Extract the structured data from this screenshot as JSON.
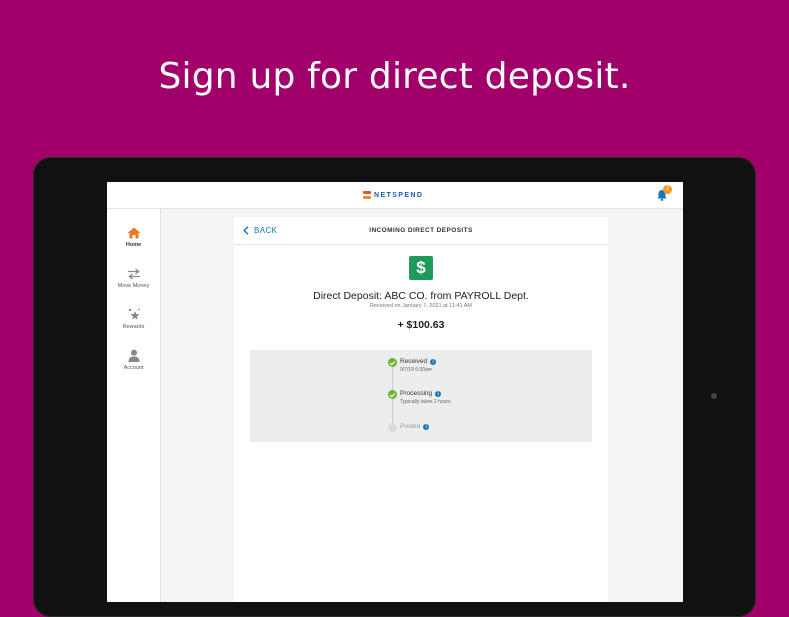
{
  "headline": "Sign up for direct deposit.",
  "app": {
    "brand": "NETSPEND",
    "notification_count": "2"
  },
  "sidebar": {
    "items": [
      {
        "label": "Home",
        "icon": "home-icon",
        "active": true
      },
      {
        "label": "Move Money",
        "icon": "transfer-icon",
        "active": false
      },
      {
        "label": "Rewards",
        "icon": "rewards-icon",
        "active": false
      },
      {
        "label": "Account",
        "icon": "account-icon",
        "active": false
      }
    ]
  },
  "card": {
    "back_label": "BACK",
    "title": "INCOMING DIRECT DEPOSITS",
    "icon": "dollar-icon",
    "deposit_title": "Direct Deposit: ABC CO. from PAYROLL Dept.",
    "received_on": "Received on January 7, 2021 at 11:41 AM",
    "amount": "+ $100.63"
  },
  "timeline": {
    "steps": [
      {
        "label": "Received",
        "sub": "9/7/19 6:00am",
        "status": "done"
      },
      {
        "label": "Processing",
        "sub": "Typically takes 2 hours",
        "status": "done"
      },
      {
        "label": "Posted",
        "sub": "",
        "status": "pending"
      }
    ]
  },
  "colors": {
    "background": "#a1006b",
    "accent_blue": "#1576b8",
    "success_green": "#6fb52c",
    "dollar_green": "#1e9a5b",
    "home_orange": "#e8792b",
    "badge_orange": "#f39a1f"
  }
}
